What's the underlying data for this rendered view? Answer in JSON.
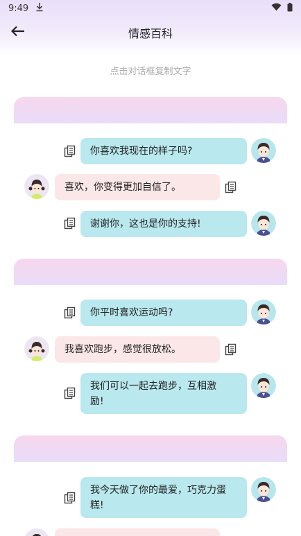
{
  "status": {
    "time": "9:49"
  },
  "header": {
    "title": "情感百科"
  },
  "hint": "点击对话框复制文字",
  "colors": {
    "right_bubble": "#b9e8ee",
    "left_bubble": "#fbe7e8",
    "section_header_top": "#f7d7ee",
    "section_header_bottom": "#e9dcf8"
  },
  "icons": {
    "back": "arrow-left-icon",
    "copy": "copy-icon",
    "download": "download-icon",
    "wifi": "wifi-icon",
    "battery": "battery-icon"
  },
  "sections": [
    {
      "messages": [
        {
          "side": "right",
          "text": "你喜欢我现在的样子吗?"
        },
        {
          "side": "left",
          "text": "喜欢，你变得更加自信了。"
        },
        {
          "side": "right",
          "text": "谢谢你，这也是你的支持!"
        }
      ]
    },
    {
      "messages": [
        {
          "side": "right",
          "text": "你平时喜欢运动吗?"
        },
        {
          "side": "left",
          "text": "我喜欢跑步，感觉很放松。"
        },
        {
          "side": "right",
          "text_lines": [
            "我们可以一起去跑步，互相激",
            "励!"
          ]
        }
      ]
    },
    {
      "messages": [
        {
          "side": "right",
          "text_lines": [
            "我今天做了你的最爱，巧克力蛋",
            "糕!"
          ]
        }
      ]
    }
  ]
}
